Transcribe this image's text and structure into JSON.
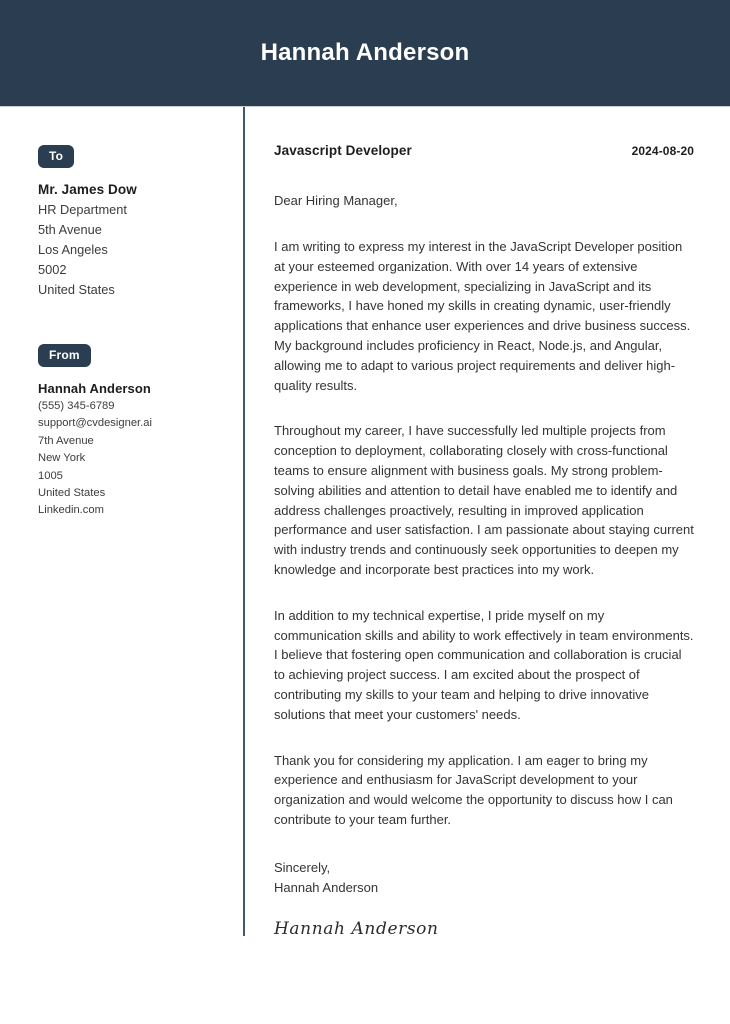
{
  "header": {
    "name": "Hannah Anderson"
  },
  "sidebar": {
    "to": {
      "badge_label": "To",
      "name": "Mr. James Dow",
      "lines": [
        "HR Department",
        "5th Avenue",
        "Los Angeles",
        "5002",
        "United States"
      ]
    },
    "from": {
      "badge_label": "From",
      "name": "Hannah Anderson",
      "lines": [
        "(555) 345-6789",
        "support@cvdesigner.ai",
        "7th Avenue",
        "New York",
        "1005",
        "United States",
        "Linkedin.com"
      ]
    }
  },
  "letter": {
    "job_title": "Javascript Developer",
    "date": "2024-08-20",
    "salutation": "Dear Hiring Manager,",
    "paragraphs": [
      "I am writing to express my interest in the JavaScript Developer position at your esteemed organization. With over 14 years of extensive experience in web development, specializing in JavaScript and its frameworks, I have honed my skills in creating dynamic, user-friendly applications that enhance user experiences and drive business success. My background includes proficiency in React, Node.js, and Angular, allowing me to adapt to various project requirements and deliver high-quality results.",
      "Throughout my career, I have successfully led multiple projects from conception to deployment, collaborating closely with cross-functional teams to ensure alignment with business goals. My strong problem-solving abilities and attention to detail have enabled me to identify and address challenges proactively, resulting in improved application performance and user satisfaction. I am passionate about staying current with industry trends and continuously seek opportunities to deepen my knowledge and incorporate best practices into my work.",
      "In addition to my technical expertise, I pride myself on my communication skills and ability to work effectively in team environments. I believe that fostering open communication and collaboration is crucial to achieving project success. I am excited about the prospect of contributing my skills to your team and helping to drive innovative solutions that meet your customers' needs.",
      "Thank you for considering my application. I am eager to bring my experience and enthusiasm for JavaScript development to your organization and would welcome the opportunity to discuss how I can contribute to your team further."
    ],
    "closing_salutation": "Sincerely,",
    "closing_name": "Hannah Anderson",
    "signature": "Hannah Anderson"
  },
  "colors": {
    "header_bg": "#2b3e51",
    "badge_bg": "#2b3e51",
    "divider": "#44566b",
    "body_text": "#343434"
  }
}
